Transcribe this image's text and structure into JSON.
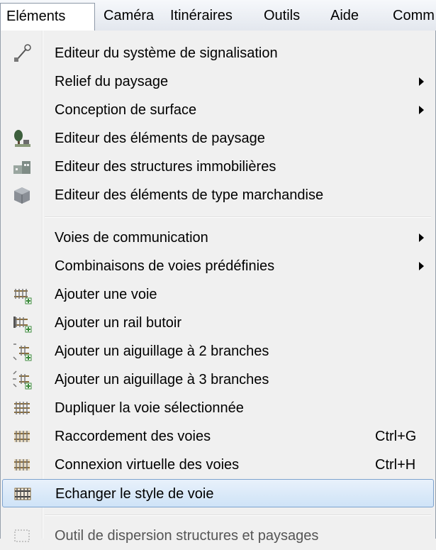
{
  "menubar": {
    "items": [
      {
        "label": "Eléments"
      },
      {
        "label": "Caméra"
      },
      {
        "label": "Itinéraires"
      },
      {
        "label": "Outils"
      },
      {
        "label": "Aide"
      },
      {
        "label": "Comm"
      }
    ]
  },
  "menu": {
    "items": [
      {
        "label": "Editeur du système de signalisation",
        "icon": "signal-editor-icon"
      },
      {
        "label": "Relief du paysage",
        "submenu": true
      },
      {
        "label": "Conception de surface",
        "submenu": true
      },
      {
        "label": "Editeur des éléments de paysage",
        "icon": "tree-icon"
      },
      {
        "label": "Editeur des structures immobilières",
        "icon": "building-icon"
      },
      {
        "label": "Editeur des éléments de type marchandise",
        "icon": "cargo-icon"
      },
      {
        "label": "Voies de communication",
        "submenu": true
      },
      {
        "label": "Combinaisons de voies prédéfinies",
        "submenu": true
      },
      {
        "label": "Ajouter une voie",
        "icon": "add-track-icon"
      },
      {
        "label": "Ajouter un rail butoir",
        "icon": "add-buffer-stop-icon"
      },
      {
        "label": "Ajouter un aiguillage à 2 branches",
        "icon": "add-switch-2-icon"
      },
      {
        "label": "Ajouter un aiguillage à 3 branches",
        "icon": "add-switch-3-icon"
      },
      {
        "label": "Dupliquer la voie sélectionnée",
        "icon": "duplicate-track-icon"
      },
      {
        "label": "Raccordement des voies",
        "shortcut": "Ctrl+G",
        "icon": "connect-tracks-icon"
      },
      {
        "label": "Connexion virtuelle des voies",
        "shortcut": "Ctrl+H",
        "icon": "virtual-connect-icon"
      },
      {
        "label": "Echanger le style de voie",
        "icon": "swap-track-style-icon",
        "highlighted": true
      },
      {
        "label": "Outil de dispersion structures et paysages",
        "icon": "scatter-tool-icon"
      }
    ]
  },
  "colors": {
    "highlight_border": "#7da2ce",
    "menu_background": "#f0f0f0",
    "track_brown": "#8a6d3b",
    "plus_green": "#3c8a3c"
  }
}
